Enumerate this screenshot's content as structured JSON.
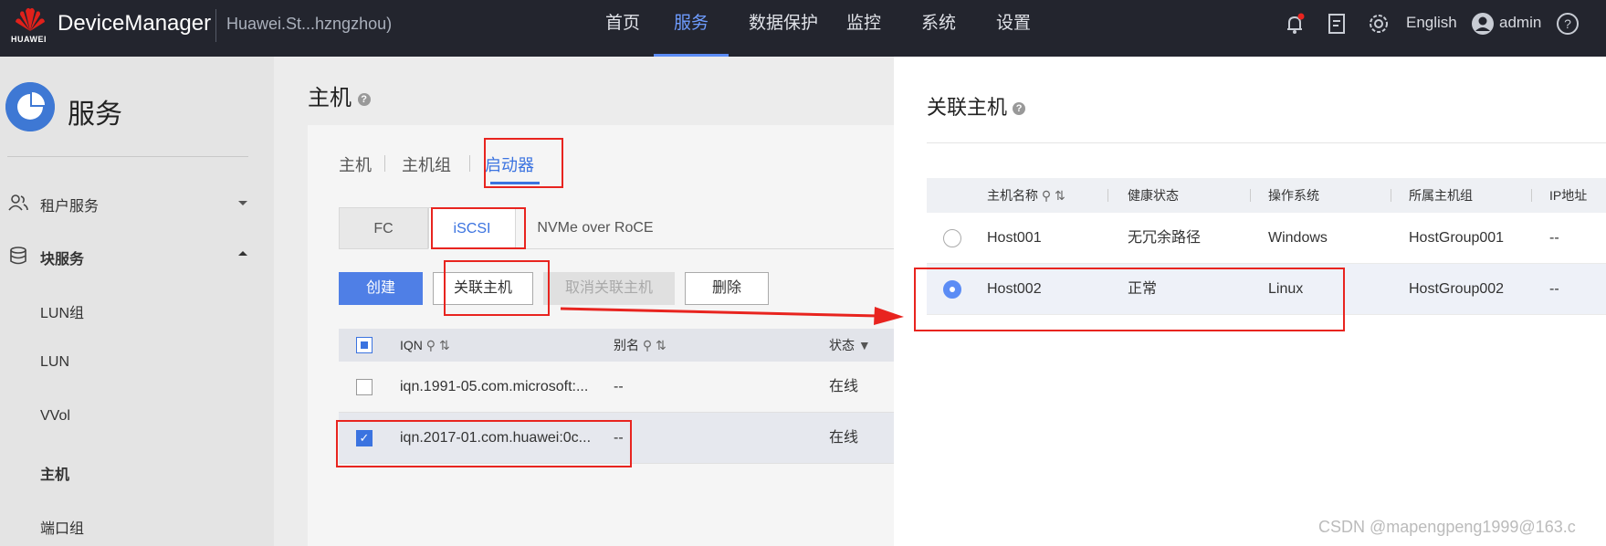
{
  "topbar": {
    "brand": "HUAWEI",
    "app_name": "DeviceManager",
    "device_name": "Huawei.St...hzngzhou)",
    "nav": [
      {
        "label": "首页"
      },
      {
        "label": "服务"
      },
      {
        "label": "数据保护"
      },
      {
        "label": "监控"
      },
      {
        "label": "系统"
      },
      {
        "label": "设置"
      }
    ],
    "language": "English",
    "user": "admin"
  },
  "sidebar": {
    "title": "服务",
    "items": [
      {
        "label": "租户服务"
      },
      {
        "label": "块服务"
      },
      {
        "label": "LUN组"
      },
      {
        "label": "LUN"
      },
      {
        "label": "VVol"
      },
      {
        "label": "主机"
      },
      {
        "label": "端口组"
      }
    ]
  },
  "main": {
    "page_title": "主机",
    "tabs": [
      {
        "label": "主机"
      },
      {
        "label": "主机组"
      },
      {
        "label": "启动器"
      }
    ],
    "subtabs": [
      {
        "label": "FC"
      },
      {
        "label": "iSCSI"
      },
      {
        "label": "NVMe over RoCE"
      }
    ],
    "buttons": {
      "create": "创建",
      "associate_host": "关联主机",
      "disassociate_host": "取消关联主机",
      "delete": "删除"
    },
    "table": {
      "headers": {
        "iqn": "IQN",
        "alias": "别名",
        "status": "状态"
      },
      "rows": [
        {
          "iqn": "iqn.1991-05.com.microsoft:...",
          "alias": "--",
          "status": "在线",
          "checked": false
        },
        {
          "iqn": "iqn.2017-01.com.huawei:0c...",
          "alias": "--",
          "status": "在线",
          "checked": true
        }
      ]
    }
  },
  "dialog": {
    "title": "关联主机",
    "headers": {
      "host_name": "主机名称",
      "health": "健康状态",
      "os": "操作系统",
      "host_group": "所属主机组",
      "ip": "IP地址"
    },
    "rows": [
      {
        "host_name": "Host001",
        "health": "无冗余路径",
        "os": "Windows",
        "host_group": "HostGroup001",
        "ip": "--",
        "selected": false
      },
      {
        "host_name": "Host002",
        "health": "正常",
        "os": "Linux",
        "host_group": "HostGroup002",
        "ip": "--",
        "selected": true
      }
    ]
  },
  "watermark": "CSDN @mapengpeng1999@163.c",
  "colors": {
    "accent": "#3b73e0",
    "annotation": "#e8241f",
    "topbar": "#23252e"
  }
}
